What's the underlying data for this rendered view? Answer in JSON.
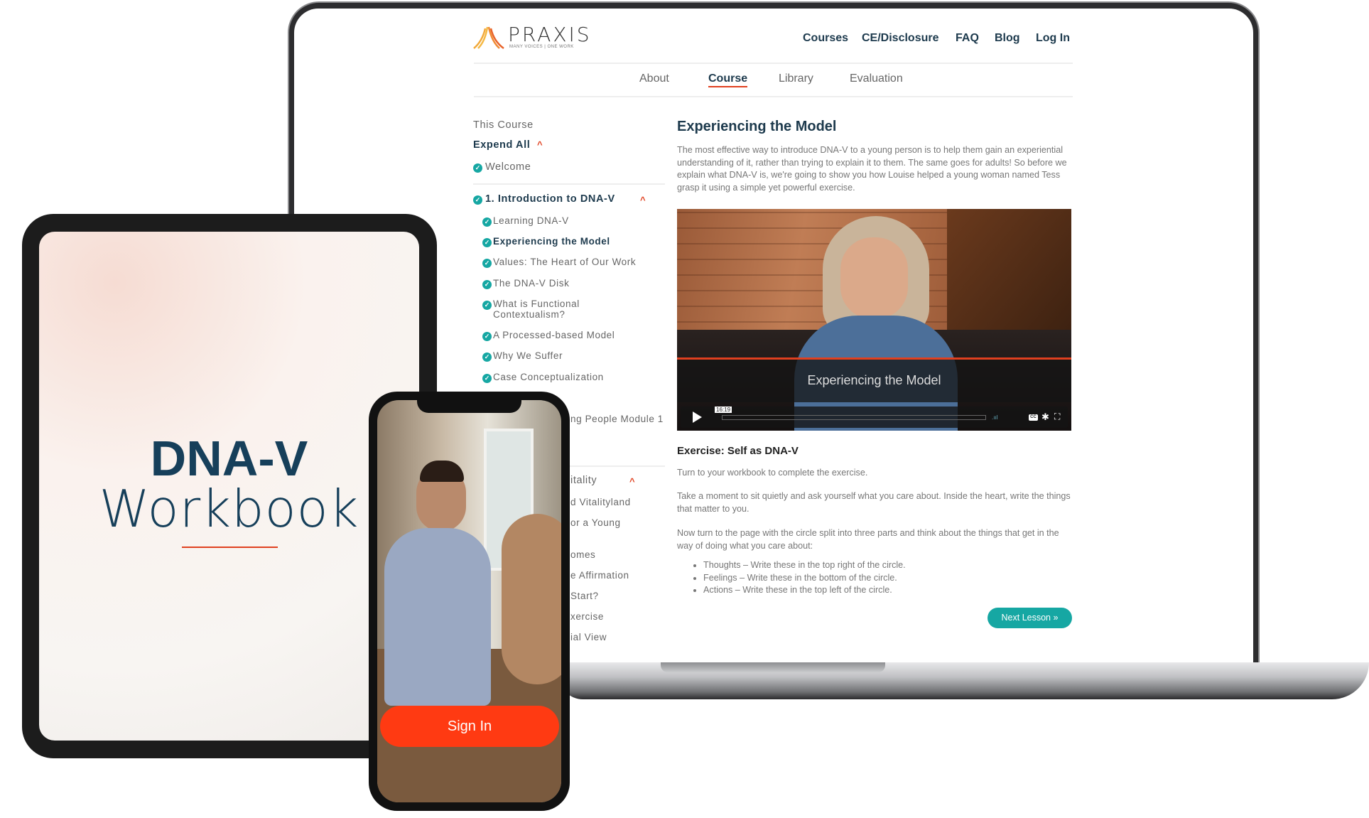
{
  "logo": {
    "name": "PRAXIS",
    "tagline": "MANY VOICES | ONE WORK"
  },
  "nav": [
    "Courses",
    "CE/Disclosure",
    "FAQ",
    "Blog",
    "Log In"
  ],
  "tabs": [
    {
      "label": "About"
    },
    {
      "label": "Course",
      "active": true
    },
    {
      "label": "Library"
    },
    {
      "label": "Evaluation"
    }
  ],
  "sidebar": {
    "heading": "This Course",
    "expand": "Expend All",
    "welcome": "Welcome",
    "module1": {
      "title": "1. Introduction to DNA-V",
      "items": [
        "Learning DNA-V",
        "Experiencing the Model",
        "Values: The Heart of Our Work",
        "The DNA-V Disk",
        "What is Functional",
        "Contextualism?",
        "A Processed-based Model",
        "Why We Suffer",
        "Case Conceptualization"
      ],
      "active": "Experiencing the Model"
    },
    "partial": [
      "ng People Module 1",
      "itality",
      "d Vitalityland",
      "or a Young",
      "omes",
      "e Affirmation",
      "Start?",
      "xercise",
      "ial View"
    ]
  },
  "main": {
    "title": "Experiencing the Model",
    "intro": "The most effective way to introduce DNA-V to a young person is to help them gain an experiential understanding of it, rather than trying to explain it to them. The same goes for adults! So before we explain what DNA-V is, we're going to show you how Louise helped a young woman named Tess grasp it using a simple yet powerful exercise.",
    "video": {
      "caption": "Experiencing the Model",
      "time": "16:19",
      "progress": 0.0
    },
    "exercise_title": "Exercise: Self as DNA-V",
    "p1": "Turn to your workbook to complete the exercise.",
    "p2": "Take a moment to sit quietly and ask yourself what you care about. Inside the heart, write the things that matter to you.",
    "p3": "Now turn to the page with the circle split into three parts and think about the things that get in the way of doing what you care about:",
    "bullets": [
      "Thoughts – Write these in the top right of the circle.",
      "Feelings – Write these in the bottom of the circle.",
      "Actions – Write these in the top left of the circle."
    ],
    "next": "Next Lesson »"
  },
  "tablet": {
    "title1": "DNA-V",
    "title2": "Workbook"
  },
  "phone": {
    "signin": "Sign In"
  },
  "colors": {
    "teal": "#16a7a3",
    "accent": "#e0401f",
    "navy": "#1d3a4d",
    "signin": "#ff3a12"
  }
}
